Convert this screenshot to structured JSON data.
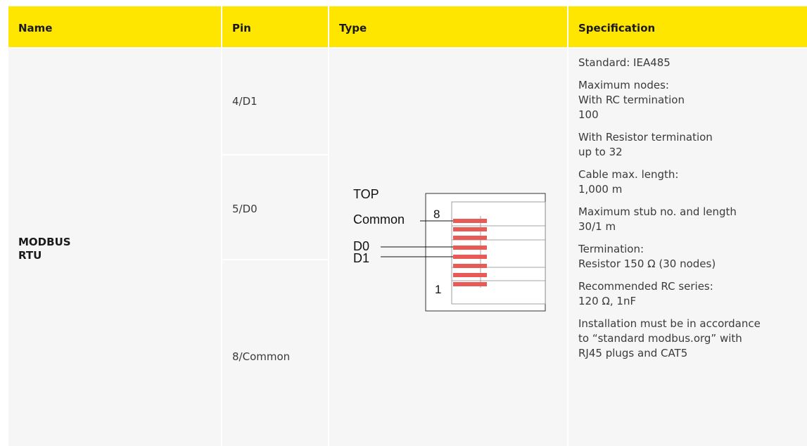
{
  "headers": {
    "name": "Name",
    "pin": "Pin",
    "type": "Type",
    "specification": "Specification"
  },
  "name": {
    "line1": "MODBUS",
    "line2": "RTU"
  },
  "pins": [
    "4/D1",
    "5/D0",
    "8/Common"
  ],
  "diagram": {
    "top_label": "TOP",
    "common_label": "Common",
    "d0_label": "D0",
    "d1_label": "D1",
    "pin8_label": "8",
    "pin1_label": "1",
    "contact_color": "#e85a55"
  },
  "specification": [
    {
      "lines": [
        "Standard: IEA485"
      ]
    },
    {
      "lines": [
        "Maximum nodes:",
        "With RC termination",
        "100"
      ]
    },
    {
      "lines": [
        "With Resistor termination",
        "up to 32"
      ]
    },
    {
      "lines": [
        "Cable max. length:",
        "1,000 m"
      ]
    },
    {
      "lines": [
        "Maximum stub no. and length",
        "30/1 m"
      ]
    },
    {
      "lines": [
        "Termination:",
        "Resistor 150 Ω (30 nodes)"
      ]
    },
    {
      "lines": [
        "Recommended RC series:",
        "120 Ω, 1nF"
      ]
    },
    {
      "lines": [
        "Installation must be in accordance",
        "to “standard modbus.org” with",
        "RJ45 plugs and CAT5"
      ]
    }
  ]
}
